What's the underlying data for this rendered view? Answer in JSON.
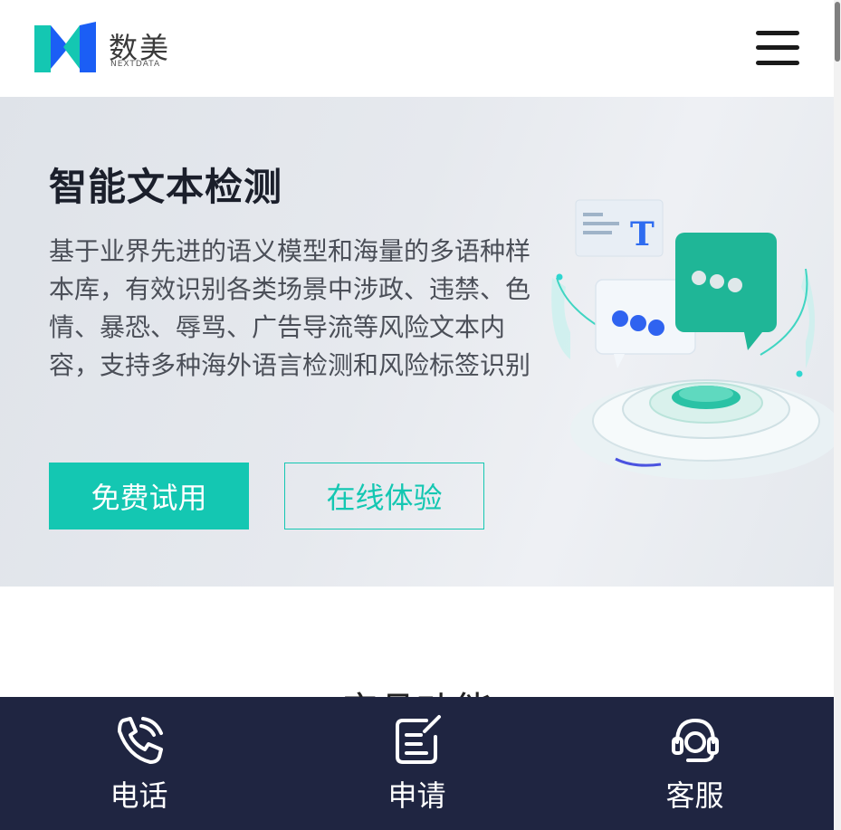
{
  "brand": {
    "name_cn": "数美",
    "name_en": "NEXTDATA",
    "colors": {
      "teal": "#14c7b2",
      "blue": "#1b5ef5",
      "dark_navy": "#1f2541"
    }
  },
  "header": {
    "menu_icon": "hamburger-menu-icon"
  },
  "hero": {
    "title": "智能文本检测",
    "description": "基于业界先进的语义模型和海量的多语种样本库，有效识别各类场景中涉政、违禁、色情、暴恐、辱骂、广告导流等风险文本内容，支持多种海外语言检测和风险标签识别",
    "primary_button": "免费试用",
    "secondary_button": "在线体验",
    "illustration_letter": "T"
  },
  "section": {
    "title": "产品功能"
  },
  "bottom_bar": {
    "items": [
      {
        "label": "电话",
        "icon": "phone-icon"
      },
      {
        "label": "申请",
        "icon": "edit-form-icon"
      },
      {
        "label": "客服",
        "icon": "headset-icon"
      }
    ]
  }
}
